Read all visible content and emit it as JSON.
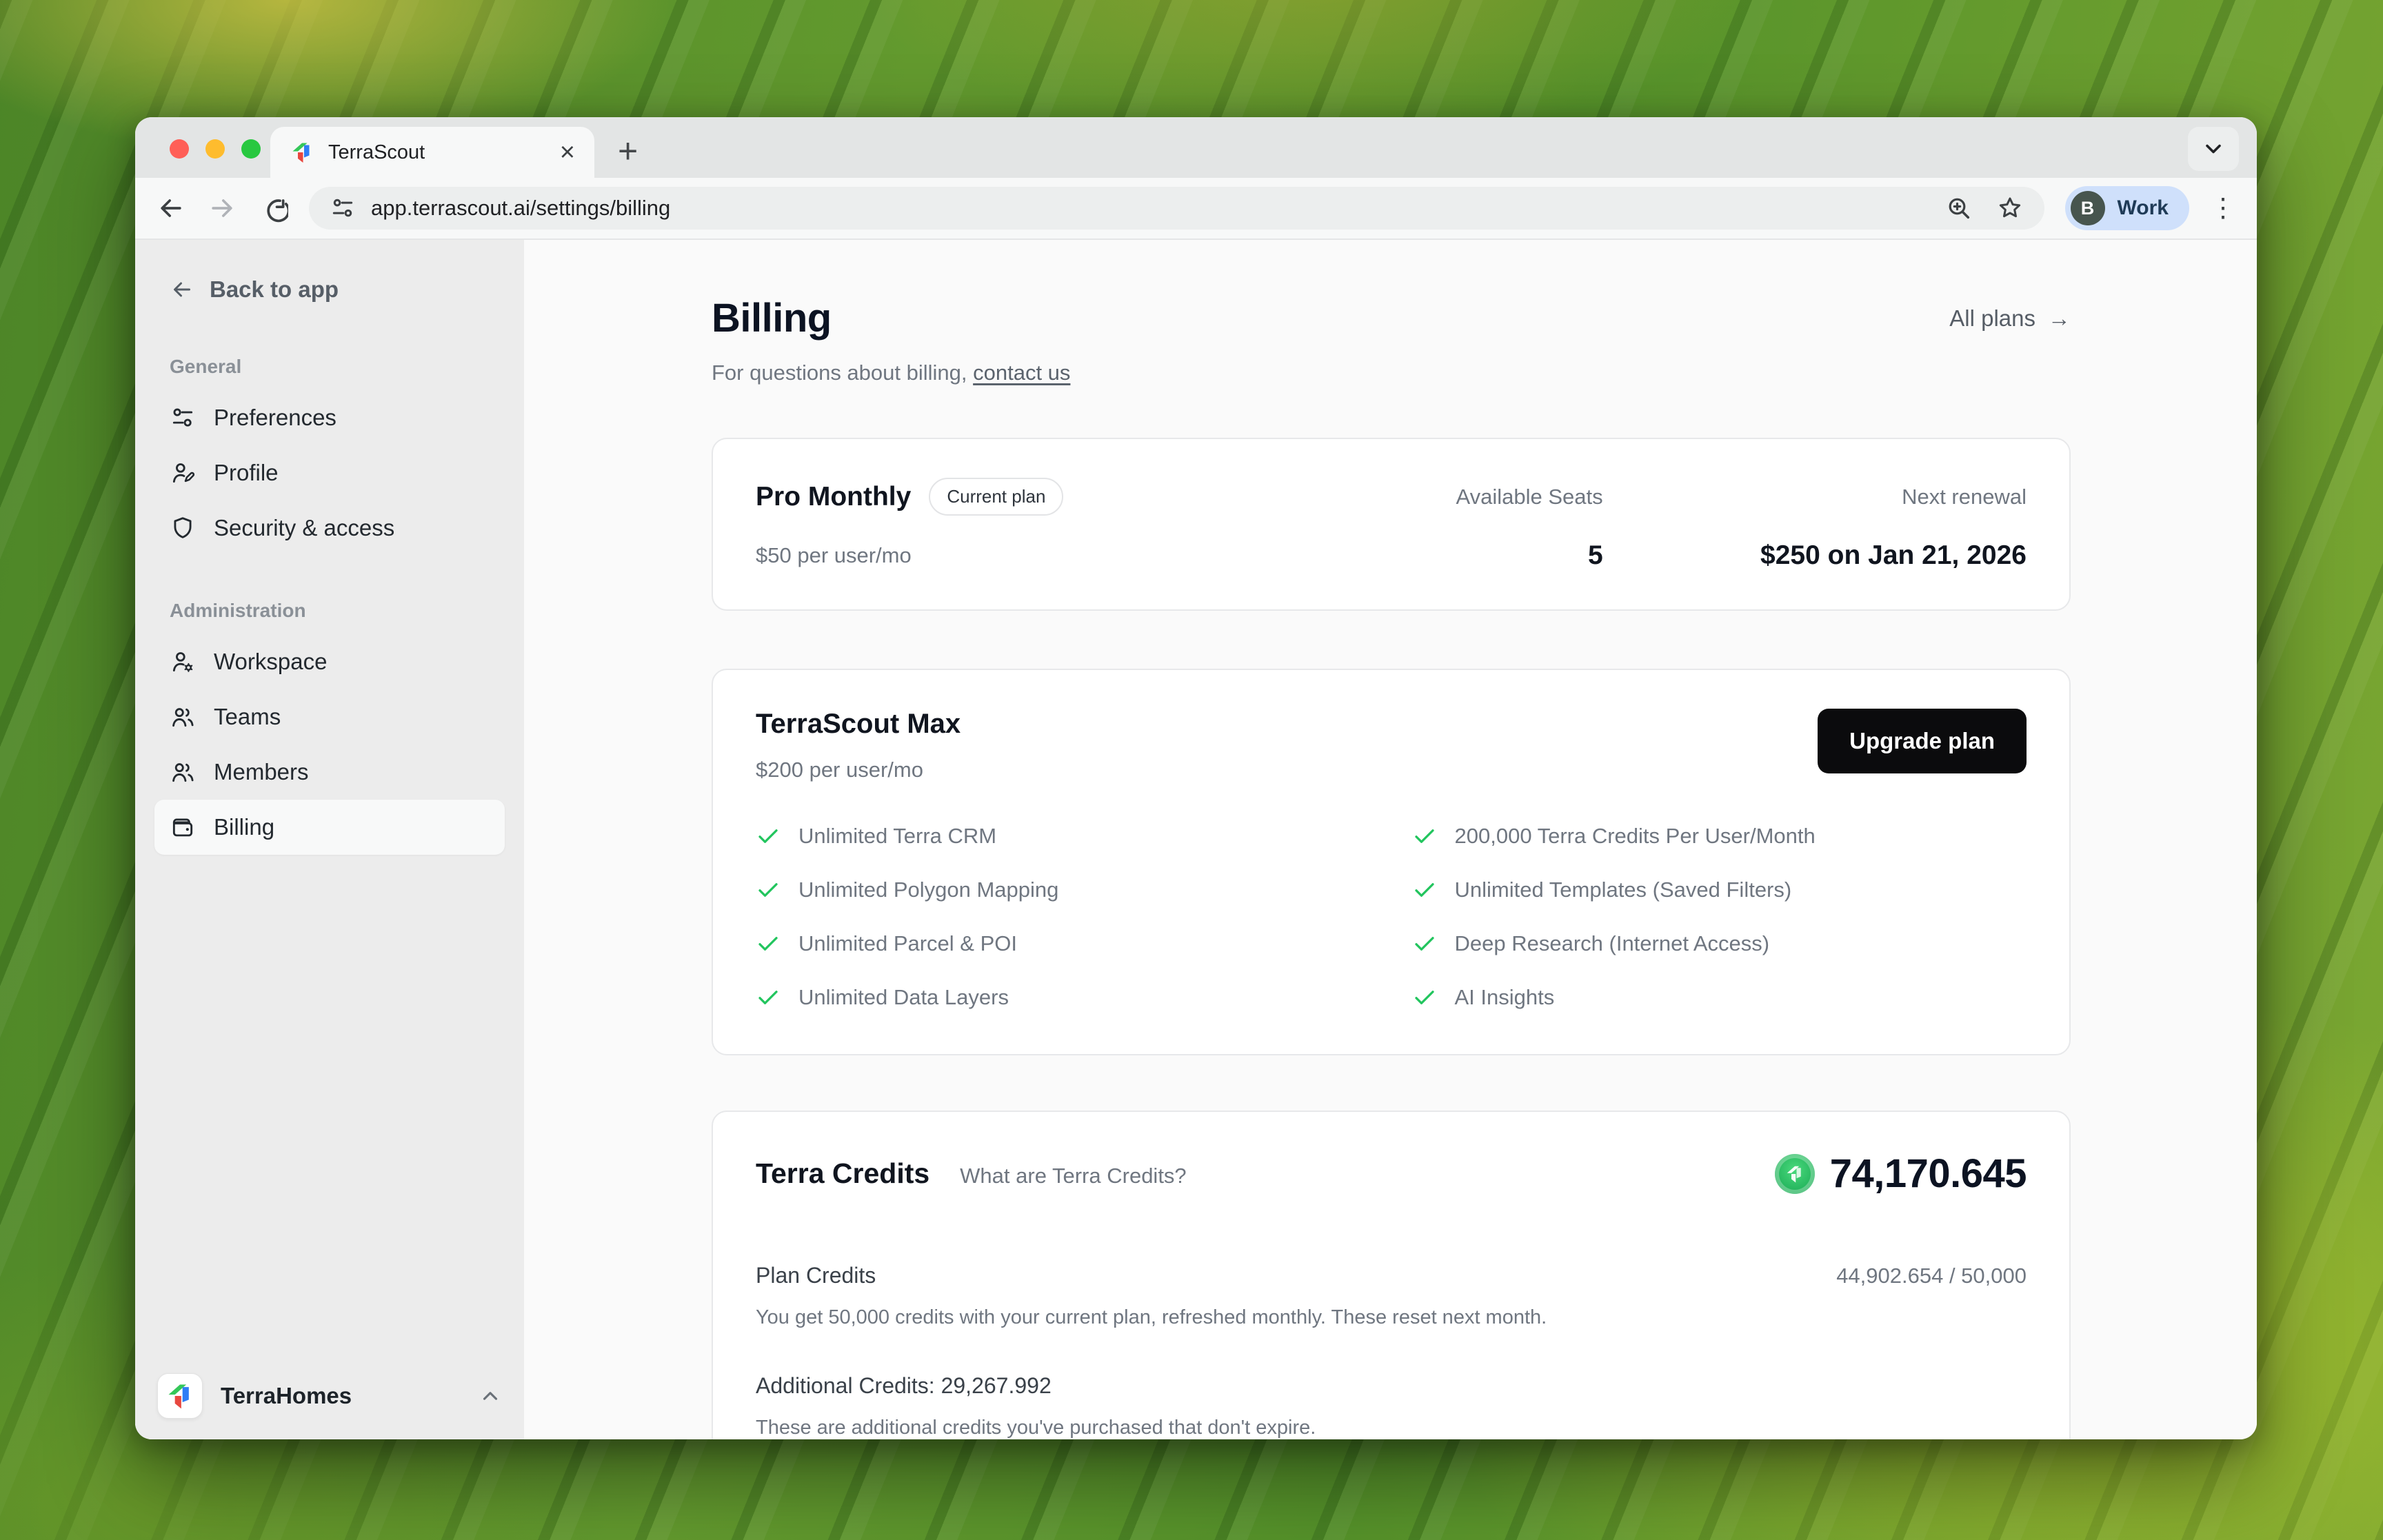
{
  "browser": {
    "tab_title": "TerraScout",
    "close_glyph": "×",
    "new_tab_glyph": "+",
    "menu_glyph": "⋮",
    "url": "app.terrascout.ai/settings/billing",
    "profile_initial": "B",
    "profile_label": "Work"
  },
  "sidebar": {
    "back_label": "Back to app",
    "sections": [
      {
        "title": "General",
        "items": [
          {
            "label": "Preferences"
          },
          {
            "label": "Profile"
          },
          {
            "label": "Security & access"
          }
        ]
      },
      {
        "title": "Administration",
        "items": [
          {
            "label": "Workspace"
          },
          {
            "label": "Teams"
          },
          {
            "label": "Members"
          },
          {
            "label": "Billing"
          }
        ]
      }
    ],
    "workspace_name": "TerraHomes"
  },
  "main": {
    "title": "Billing",
    "subtitle_prefix": "For questions about billing, ",
    "contact_link": "contact us",
    "all_plans_label": "All plans",
    "all_plans_arrow": "→"
  },
  "plan_card": {
    "name": "Pro Monthly",
    "badge": "Current plan",
    "price": "$50 per user/mo",
    "seats_label": "Available Seats",
    "seats_value": "5",
    "renewal_label": "Next renewal",
    "renewal_value": "$250 on Jan 21, 2026"
  },
  "upgrade_card": {
    "name": "TerraScout Max",
    "price": "$200 per user/mo",
    "button": "Upgrade plan",
    "features_left": [
      "Unlimited Terra CRM",
      "Unlimited Polygon Mapping",
      "Unlimited Parcel & POI",
      "Unlimited Data Layers"
    ],
    "features_right": [
      "200,000 Terra Credits Per User/Month",
      "Unlimited Templates (Saved Filters)",
      "Deep Research (Internet Access)",
      "AI Insights"
    ]
  },
  "credits_card": {
    "title": "Terra Credits",
    "link": "What are Terra Credits?",
    "balance": "74,170.645",
    "plan_credits_label": "Plan Credits",
    "plan_credits_value": "44,902.654 / 50,000",
    "plan_credits_desc": "You get 50,000 credits with your current plan, refreshed monthly. These reset next month.",
    "additional_label": "Additional Credits: 29,267.992",
    "additional_desc": "These are additional credits you've purchased that don't expire."
  },
  "colors": {
    "check_green": "#22c55e",
    "coin_green": "#23b35c",
    "button_black": "#0b0b0d",
    "profile_chip_blue": "#cfe0fb",
    "accent_text_dark": "#0c1322"
  }
}
